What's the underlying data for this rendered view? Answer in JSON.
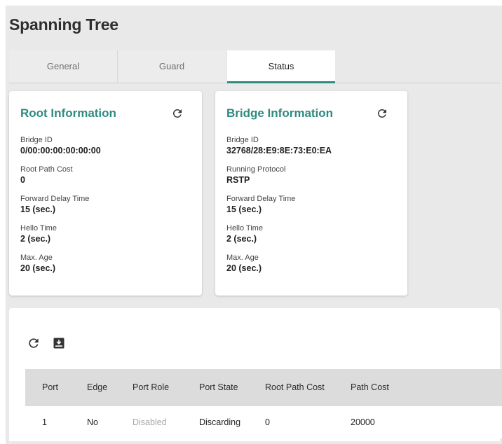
{
  "page": {
    "title": "Spanning Tree"
  },
  "tabs": [
    {
      "label": "General"
    },
    {
      "label": "Guard"
    },
    {
      "label": "Status",
      "active": true
    }
  ],
  "root_info": {
    "title": "Root Information",
    "refresh_icon": "refresh-icon",
    "fields": [
      {
        "label": "Bridge ID",
        "value": "0/00:00:00:00:00:00"
      },
      {
        "label": "Root Path Cost",
        "value": "0"
      },
      {
        "label": "Forward Delay Time",
        "value": "15 (sec.)"
      },
      {
        "label": "Hello Time",
        "value": "2 (sec.)"
      },
      {
        "label": "Max. Age",
        "value": "20 (sec.)"
      }
    ]
  },
  "bridge_info": {
    "title": "Bridge Information",
    "refresh_icon": "refresh-icon",
    "fields": [
      {
        "label": "Bridge ID",
        "value": "32768/28:E9:8E:73:E0:EA"
      },
      {
        "label": "Running Protocol",
        "value": "RSTP"
      },
      {
        "label": "Forward Delay Time",
        "value": "15 (sec.)"
      },
      {
        "label": "Hello Time",
        "value": "2 (sec.)"
      },
      {
        "label": "Max. Age",
        "value": "20 (sec.)"
      }
    ]
  },
  "toolbar": {
    "refresh_icon": "refresh-icon",
    "export_icon": "export-icon"
  },
  "table": {
    "columns": [
      "Port",
      "Edge",
      "Port Role",
      "Port State",
      "Root Path Cost",
      "Path Cost"
    ],
    "rows": [
      [
        "1",
        "No",
        "Disabled",
        "Discarding",
        "0",
        "20000"
      ]
    ]
  },
  "colors": {
    "accent": "#2f8a80",
    "background": "#e9e9e9",
    "header": "#dcdcdc",
    "muted": "#a8a8a8"
  }
}
